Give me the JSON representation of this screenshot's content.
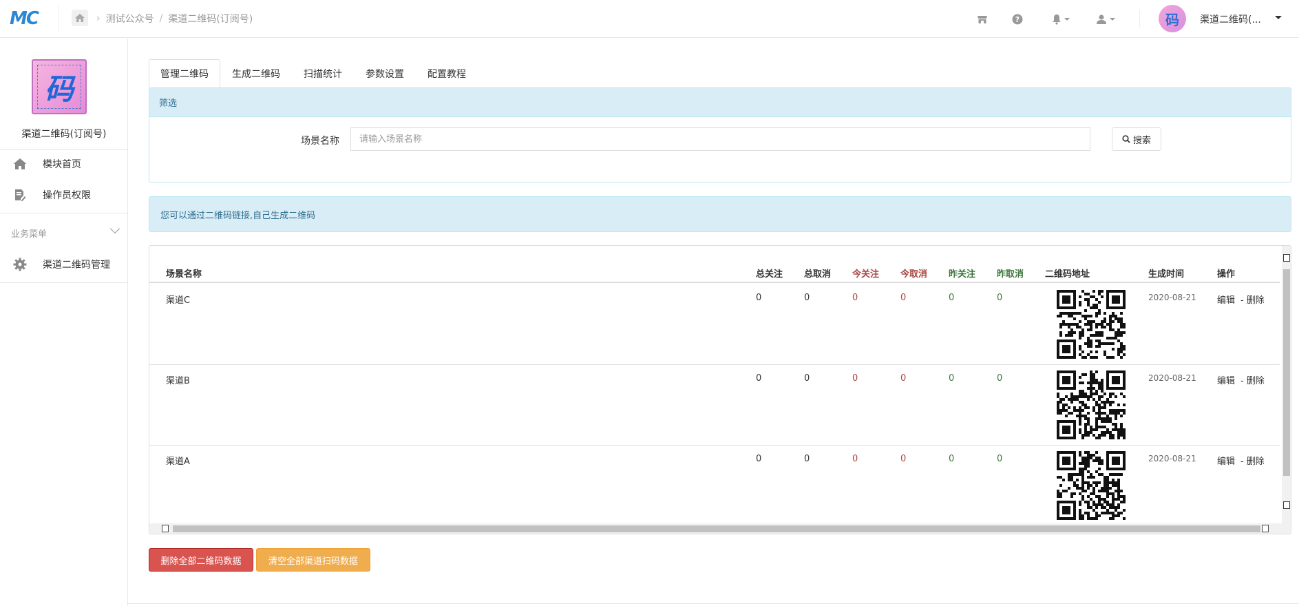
{
  "header": {
    "logo_text": "MC",
    "breadcrumb": [
      "测试公众号",
      "渠道二维码(订阅号)"
    ],
    "breadcrumb_sep": "/",
    "username": "渠道二维码(..."
  },
  "sidebar": {
    "logo_char": "码",
    "title": "渠道二维码(订阅号)",
    "items": [
      {
        "label": "模块首页",
        "icon": "home-icon"
      },
      {
        "label": "操作员权限",
        "icon": "document-edit-icon"
      }
    ],
    "group_label": "业务菜单",
    "group_items": [
      {
        "label": "渠道二维码管理",
        "icon": "gear-icon"
      }
    ]
  },
  "tabs": [
    {
      "label": "管理二维码",
      "active": true
    },
    {
      "label": "生成二维码",
      "active": false
    },
    {
      "label": "扫描统计",
      "active": false
    },
    {
      "label": "参数设置",
      "active": false
    },
    {
      "label": "配置教程",
      "active": false
    }
  ],
  "filter": {
    "heading": "筛选",
    "scene_label": "场景名称",
    "scene_placeholder": "请输入场景名称",
    "search_label": "搜索"
  },
  "info_alert": "您可以通过二维码链接,自己生成二维码",
  "table": {
    "headers": [
      "场景名称",
      "总关注",
      "总取消",
      "今关注",
      "今取消",
      "昨关注",
      "昨取消",
      "二维码地址",
      "生成时间",
      "操作"
    ],
    "rows": [
      {
        "scene": "渠道C",
        "total_follow": "0",
        "total_cancel": "0",
        "today_follow": "0",
        "today_cancel": "0",
        "yest_follow": "0",
        "yest_cancel": "0",
        "created": "2020-08-21",
        "edit": "编辑",
        "delete": "删除"
      },
      {
        "scene": "渠道B",
        "total_follow": "0",
        "total_cancel": "0",
        "today_follow": "0",
        "today_cancel": "0",
        "yest_follow": "0",
        "yest_cancel": "0",
        "created": "2020-08-21",
        "edit": "编辑",
        "delete": "删除"
      },
      {
        "scene": "渠道A",
        "total_follow": "0",
        "total_cancel": "0",
        "today_follow": "0",
        "today_cancel": "0",
        "yest_follow": "0",
        "yest_cancel": "0",
        "created": "2020-08-21",
        "edit": "编辑",
        "delete": "删除"
      }
    ],
    "op_sep": "-"
  },
  "buttons": {
    "delete_all": "删除全部二维码数据",
    "clear_all": "清空全部渠道扫码数据"
  },
  "colors": {
    "accent": "#2b86d3",
    "danger": "#d9534f",
    "warning": "#f0ad4e",
    "info_bg": "#d9edf7",
    "info_text": "#31708f",
    "today_red": "#a94442",
    "yesterday_green": "#3c763d"
  }
}
